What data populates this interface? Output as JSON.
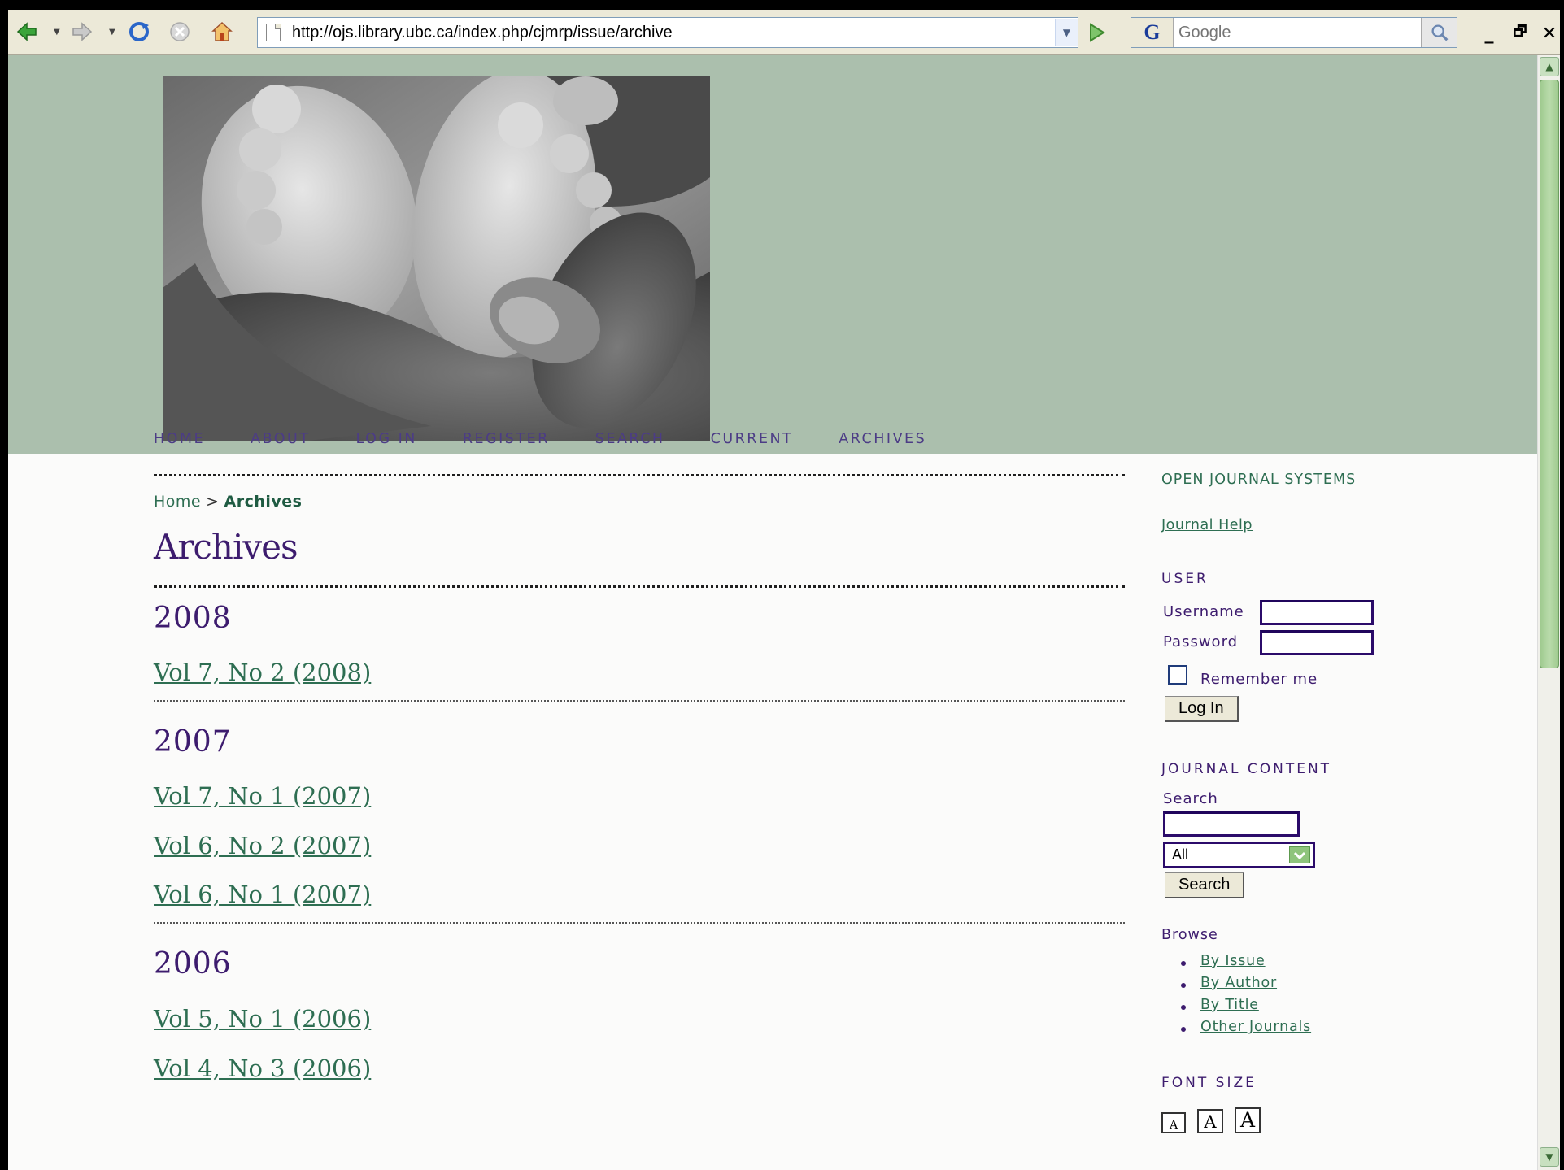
{
  "browser": {
    "url": "http://ojs.library.ubc.ca/index.php/cjmrp/issue/archive",
    "search_placeholder": "Google",
    "google_logo": "G",
    "icons": [
      "back-arrow-icon",
      "forward-arrow-icon",
      "refresh-icon",
      "stop-icon",
      "home-icon",
      "page-icon",
      "go-icon",
      "magnifier-icon"
    ],
    "window_controls": {
      "minimize": "_",
      "restore": "🗗",
      "close": "✕"
    }
  },
  "nav": {
    "items": [
      "HOME",
      "ABOUT",
      "LOG IN",
      "REGISTER",
      "SEARCH",
      "CURRENT",
      "ARCHIVES"
    ]
  },
  "breadcrumb": {
    "home": "Home",
    "separator": ">",
    "current": "Archives"
  },
  "page_title": "Archives",
  "archives": [
    {
      "year": "2008",
      "issues": [
        "Vol 7, No 2 (2008)"
      ]
    },
    {
      "year": "2007",
      "issues": [
        "Vol 7, No 1 (2007)",
        "Vol 6, No 2 (2007)",
        "Vol 6, No 1 (2007)"
      ]
    },
    {
      "year": "2006",
      "issues": [
        "Vol 5, No 1 (2006)",
        "Vol 4, No 3 (2006)"
      ]
    }
  ],
  "sidebar": {
    "ojs_link": "OPEN JOURNAL SYSTEMS",
    "help_link": "Journal Help",
    "user": {
      "heading": "USER",
      "username_label": "Username",
      "password_label": "Password",
      "remember_label": "Remember me",
      "login_button": "Log In"
    },
    "journal_content": {
      "heading": "JOURNAL CONTENT",
      "search_label": "Search",
      "scope_selected": "All",
      "search_button": "Search",
      "browse_label": "Browse",
      "browse_links": [
        "By Issue",
        "By Author",
        "By Title",
        "Other Journals"
      ]
    },
    "font_size": {
      "heading": "FONT SIZE",
      "buttons": [
        "A",
        "A",
        "A"
      ]
    }
  },
  "colors": {
    "banner": "#abbfad",
    "link": "#2e6e52",
    "heading": "#3d1c6e",
    "nav": "#4c3c86"
  }
}
